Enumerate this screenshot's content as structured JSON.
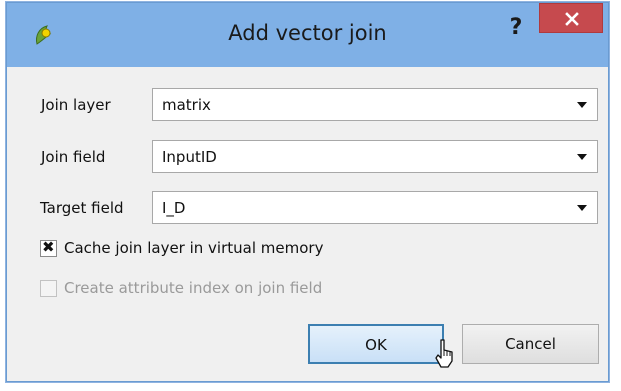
{
  "window": {
    "title": "Add vector join",
    "help_label": "?"
  },
  "form": {
    "join_layer": {
      "label": "Join layer",
      "value": "matrix"
    },
    "join_field": {
      "label": "Join field",
      "value": "InputID"
    },
    "target_field": {
      "label": "Target field",
      "value": "I_D"
    }
  },
  "options": {
    "cache": {
      "label": "Cache join layer in virtual memory",
      "checked": true,
      "mark": "✖"
    },
    "attribute_index": {
      "label": "Create attribute index on join field",
      "checked": false,
      "enabled": false
    }
  },
  "buttons": {
    "ok_label": "OK",
    "cancel_label": "Cancel"
  },
  "colors": {
    "titlebar": "#7fb0e6",
    "close": "#c64a4e",
    "ok_border": "#3c7fb1"
  },
  "icons": {
    "app": "qgis-logo-icon",
    "close": "close-icon",
    "help": "help-icon",
    "dropdown": "chevron-down-icon",
    "cursor": "mouse-pointer-icon"
  }
}
